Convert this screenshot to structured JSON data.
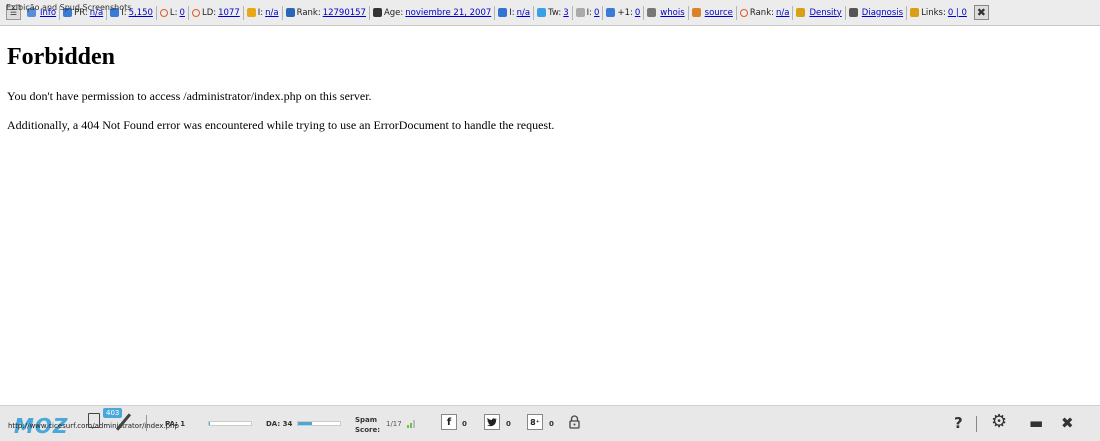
{
  "seo_toolbar": {
    "caption": "Exibição and Spud Screenshots",
    "items": [
      {
        "label": "",
        "link": "Info",
        "icon": "info-icon",
        "color": "#5a8fd8"
      },
      {
        "label": "PR:",
        "link": "n/a",
        "icon": "google-icon",
        "color": "#3a7bd5"
      },
      {
        "label": "I:",
        "link": "5,150",
        "icon": "google-index-icon",
        "color": "#3a7bd5"
      },
      {
        "label": "L:",
        "link": "0",
        "icon": "yahoo-links-icon",
        "color": "#e05a2b"
      },
      {
        "label": "LD:",
        "link": "1077",
        "icon": "link-domains-icon",
        "color": "#e05a2b"
      },
      {
        "label": "I:",
        "link": "n/a",
        "icon": "bing-icon",
        "color": "#e6a817"
      },
      {
        "label": "Rank:",
        "link": "12790157",
        "icon": "alexa-icon",
        "color": "#2a66b8"
      },
      {
        "label": "Age:",
        "link": "noviembre 21, 2007",
        "icon": "calendar-icon",
        "color": "#333333"
      },
      {
        "label": "I:",
        "link": "n/a",
        "icon": "delicious-icon",
        "color": "#3274d1"
      },
      {
        "label": "Tw:",
        "link": "3",
        "icon": "twitter-icon",
        "color": "#3aa0e6"
      },
      {
        "label": "I:",
        "link": "0",
        "icon": "page-icon",
        "color": "#aaaaaa"
      },
      {
        "label": "+1:",
        "link": "0",
        "icon": "gplus-icon",
        "color": "#3a7bd5"
      },
      {
        "label": "",
        "link": "whois",
        "icon": "whois-icon",
        "color": "#777777"
      },
      {
        "label": "",
        "link": "source",
        "icon": "source-icon",
        "color": "#d9822b"
      },
      {
        "label": "Rank:",
        "link": "n/a",
        "icon": "rank-ring-icon",
        "color": "#e05a2b"
      },
      {
        "label": "",
        "link": "Density",
        "icon": "density-icon",
        "color": "#d9a017"
      },
      {
        "label": "",
        "link": "Diagnosis",
        "icon": "diagnosis-icon",
        "color": "#555555"
      },
      {
        "label": "Links:",
        "link": "0 | 0",
        "icon": "links-icon",
        "color": "#d9a017"
      }
    ],
    "close_label": "✖"
  },
  "page": {
    "title": "Forbidden",
    "message1": "You don't have permission to access /administrator/index.php on this server.",
    "message2": "Additionally, a 404 Not Found error was encountered while trying to use an ErrorDocument to handle the request."
  },
  "moz_bar": {
    "logo": "MOZ",
    "url": "http://www.cicesurf.com/administrator/index.php",
    "badge": "403",
    "pa_label": "PA: 1",
    "pa_fraction": 0.02,
    "da_label": "DA: 34",
    "da_fraction": 0.34,
    "spam_label_1": "Spam",
    "spam_label_2": "Score:",
    "spam_value": "1/17",
    "facebook_glyph": "f",
    "facebook_count": "0",
    "twitter_glyph": "🐦",
    "twitter_count": "0",
    "gplus_glyph": "8⁺",
    "gplus_count": "0",
    "help_glyph": "?",
    "settings_glyph": "⚙",
    "menu_glyph": "▬",
    "close_glyph": "✖",
    "accent_color": "#4aa8d8"
  }
}
